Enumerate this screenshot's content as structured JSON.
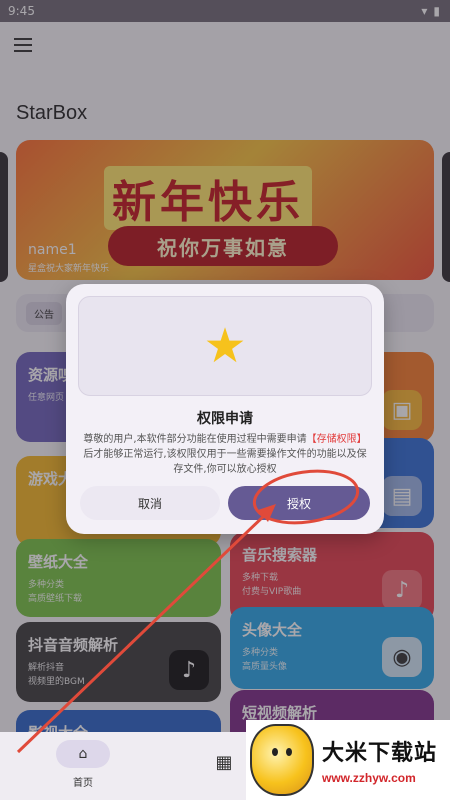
{
  "status_bar": {
    "time": "9:45"
  },
  "app": {
    "title": "StarBox"
  },
  "banner": {
    "headline": "新年快乐",
    "subline": "祝你万事如意",
    "name": "name1",
    "caption": "星盒祝大家新年快乐"
  },
  "notice": {
    "tag": "公告"
  },
  "left_cards": [
    {
      "title": "资源嗅",
      "line1": "任意网页",
      "line2": ""
    },
    {
      "title": "游戏大",
      "line1": "",
      "line2": ""
    },
    {
      "title": "壁纸大全",
      "line1": "多种分类",
      "line2": "高质壁纸下载"
    },
    {
      "title": "抖音音频解析",
      "line1": "解析抖音",
      "line2": "视频里的BGM"
    },
    {
      "title": "影视大全",
      "line1": "",
      "line2": ""
    }
  ],
  "right_cards": [
    {
      "title": "",
      "line1": "",
      "line2": ""
    },
    {
      "title": "",
      "line1": "",
      "line2": ""
    },
    {
      "title": "音乐搜索器",
      "line1": "多种下载",
      "line2": "付费与VIP歌曲"
    },
    {
      "title": "头像大全",
      "line1": "多种分类",
      "line2": "高质量头像"
    },
    {
      "title": "短视频解析",
      "line1": "",
      "line2": ""
    }
  ],
  "dialog": {
    "title": "权限申请",
    "body_before": "尊敬的用户,本软件部分功能在使用过程中需要申请",
    "body_highlight": "【存储权限】",
    "body_after": "后才能够正常运行,该权限仅用于一些需要操作文件的功能以及保存文件,你可以放心授权",
    "cancel_label": "取消",
    "grant_label": "授权"
  },
  "bottom_nav": {
    "home_label": "首页"
  },
  "watermark": {
    "brand": "大米下载站",
    "url": "www.zzhyw.com"
  },
  "colors": {
    "accent": "#655a94",
    "highlight": "#e23b3b",
    "annotation": "#e04a3a"
  }
}
